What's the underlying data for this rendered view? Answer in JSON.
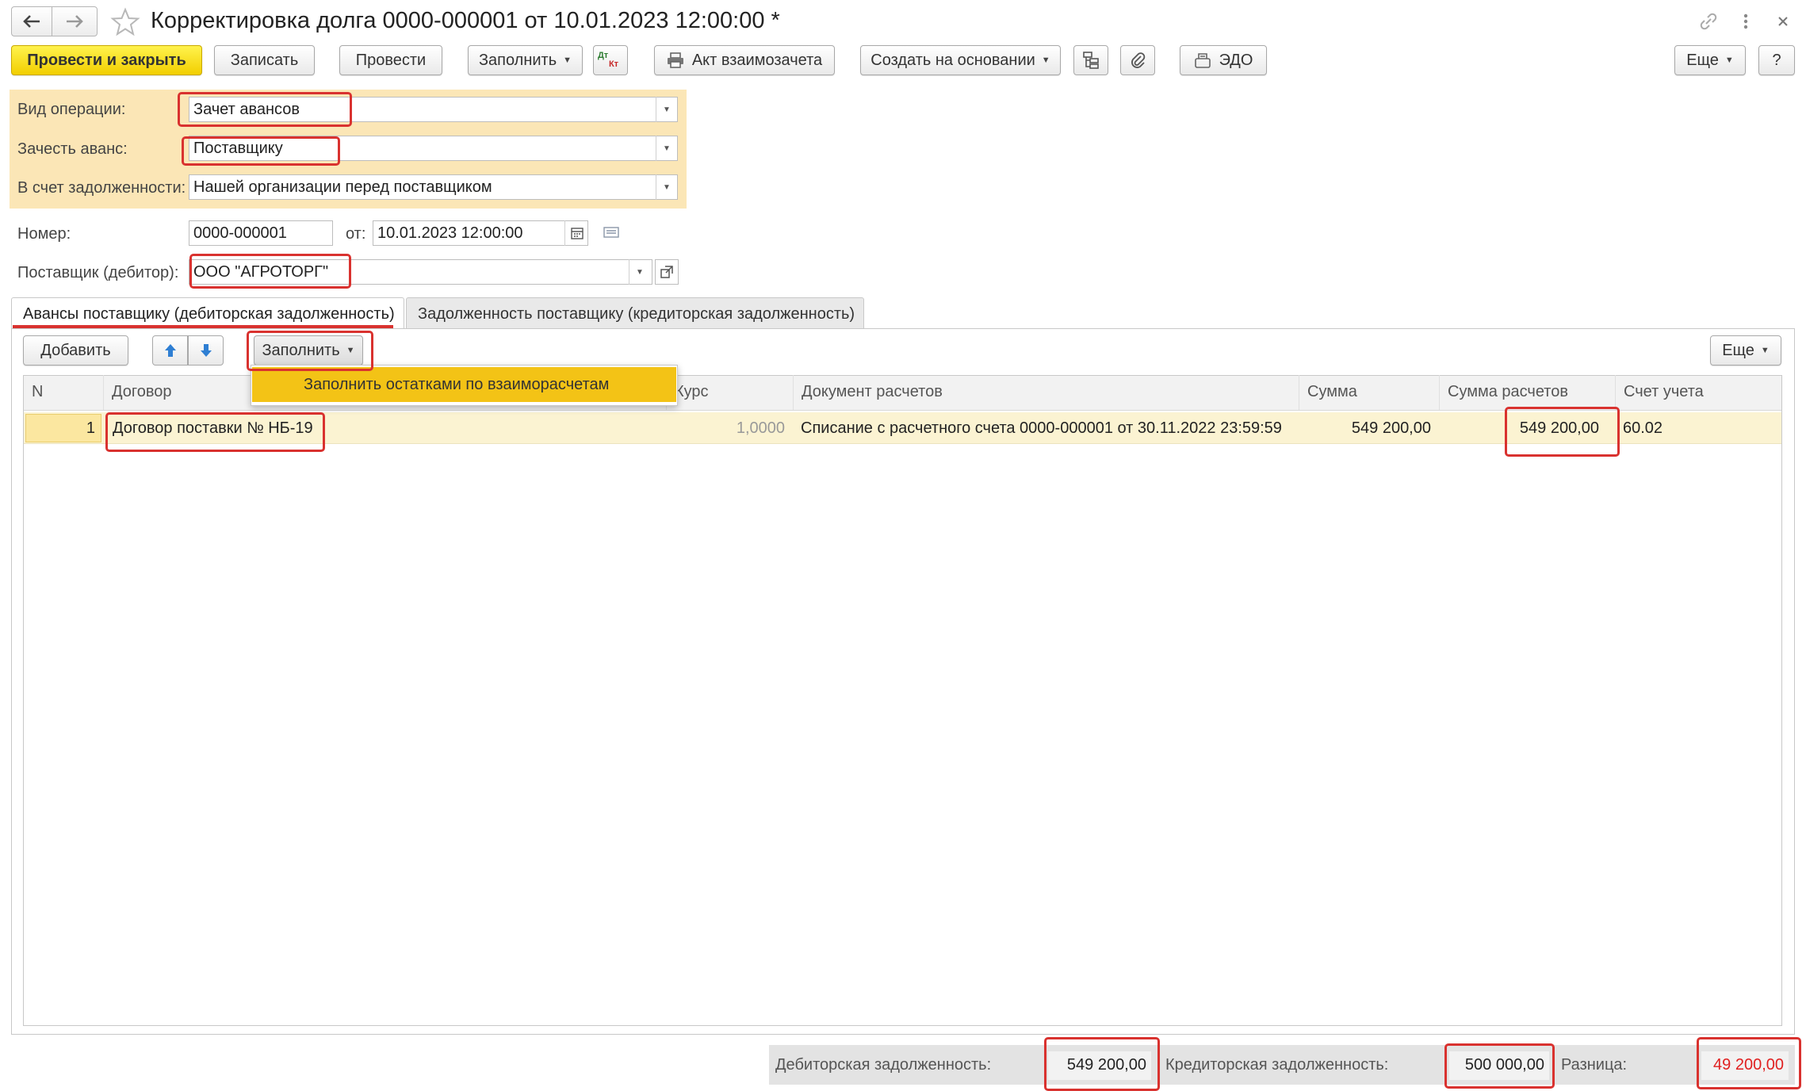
{
  "window": {
    "title": "Корректировка долга 0000-000001 от 10.01.2023 12:00:00 *"
  },
  "toolbar": {
    "post_and_close": "Провести и закрыть",
    "save": "Записать",
    "post": "Провести",
    "fill": "Заполнить",
    "dt_kt_top": "Дт",
    "dt_kt_bottom": "Кт",
    "offset_act": "Акт взаимозачета",
    "create_based_on": "Создать на основании",
    "edo": "ЭДО",
    "more": "Еще",
    "help": "?"
  },
  "header_fields": {
    "operation_type": {
      "label": "Вид операции:",
      "value": "Зачет авансов"
    },
    "offset_advance": {
      "label": "Зачесть аванс:",
      "value": "Поставщику"
    },
    "debt_account": {
      "label": "В счет задолженности:",
      "value": "Нашей организации перед поставщиком"
    },
    "number": {
      "label": "Номер:",
      "value": "0000-000001"
    },
    "date": {
      "label": "от:",
      "value": "10.01.2023 12:00:00"
    },
    "supplier": {
      "label": "Поставщик (дебитор):",
      "value": "ООО \"АГРОТОРГ\""
    }
  },
  "tabs": [
    {
      "label": "Авансы поставщику (дебиторская задолженность)",
      "active": true
    },
    {
      "label": "Задолженность поставщику (кредиторская задолженность)",
      "active": false
    }
  ],
  "table_toolbar": {
    "add": "Добавить",
    "fill": "Заполнить",
    "more": "Еще"
  },
  "fill_menu": {
    "items": [
      "Заполнить остатками по взаиморасчетам"
    ]
  },
  "table": {
    "columns": [
      "N",
      "Договор",
      "Курс",
      "Документ расчетов",
      "Сумма",
      "Сумма расчетов",
      "Счет учета"
    ],
    "rows": [
      {
        "n": "1",
        "contract": "Договор поставки № НБ-19",
        "rate": "1,0000",
        "document": "Списание с расчетного счета 0000-000001 от 30.11.2022 23:59:59",
        "amount": "549 200,00",
        "settlement_amount": "549 200,00",
        "account": "60.02"
      }
    ]
  },
  "footer": {
    "receivable_label": "Дебиторская задолженность:",
    "receivable_value": "549 200,00",
    "payable_label": "Кредиторская задолженность:",
    "payable_value": "500 000,00",
    "difference_label": "Разница:",
    "difference_value": "49 200,00"
  },
  "colors": {
    "primary_button": "#f5d800",
    "form_highlight": "#fbe6b6",
    "selected_row": "#fbf3d2",
    "annotation_red": "#d9322f",
    "menu_highlight": "#f3c316",
    "difference_text": "#e02020"
  }
}
